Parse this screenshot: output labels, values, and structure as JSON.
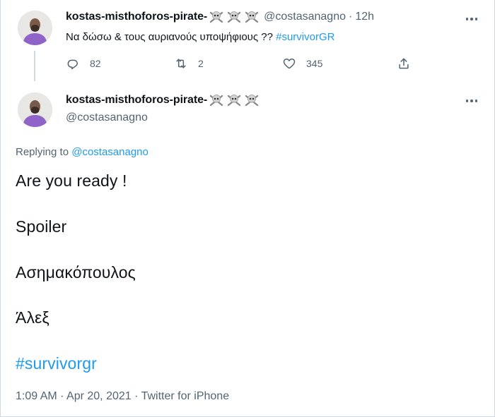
{
  "tweet1": {
    "display_name": "kostas-misthoforos-pirate-",
    "emoji_icons": [
      "skull-and-crossbones-icon",
      "skull-and-crossbones-icon",
      "skull-and-crossbones-icon"
    ],
    "handle": "@costasanagno",
    "separator": "·",
    "time": "12h",
    "text": "Να δώσω & τους αυριανούς υποψήφιους ?? ",
    "hashtag": "#survivorGR",
    "replies": "82",
    "retweets": "2",
    "likes": "345"
  },
  "tweet2": {
    "display_name": "kostas-misthoforos-pirate-",
    "handle": "@costasanagno",
    "replying_prefix": "Replying to ",
    "replying_to": "@costasanagno",
    "lines": [
      "Are you ready !",
      "Spoiler",
      "Ασημακόπουλος",
      "Άλεξ"
    ],
    "hashtag": "#survivorgr",
    "timestamp": "1:09 AM · Apr 20, 2021 · Twitter for iPhone"
  },
  "colors": {
    "link": "#1d9bf0",
    "secondary_text": "#536471",
    "primary_text": "#0f1419",
    "avatar_shirt": "#8f63c8"
  }
}
